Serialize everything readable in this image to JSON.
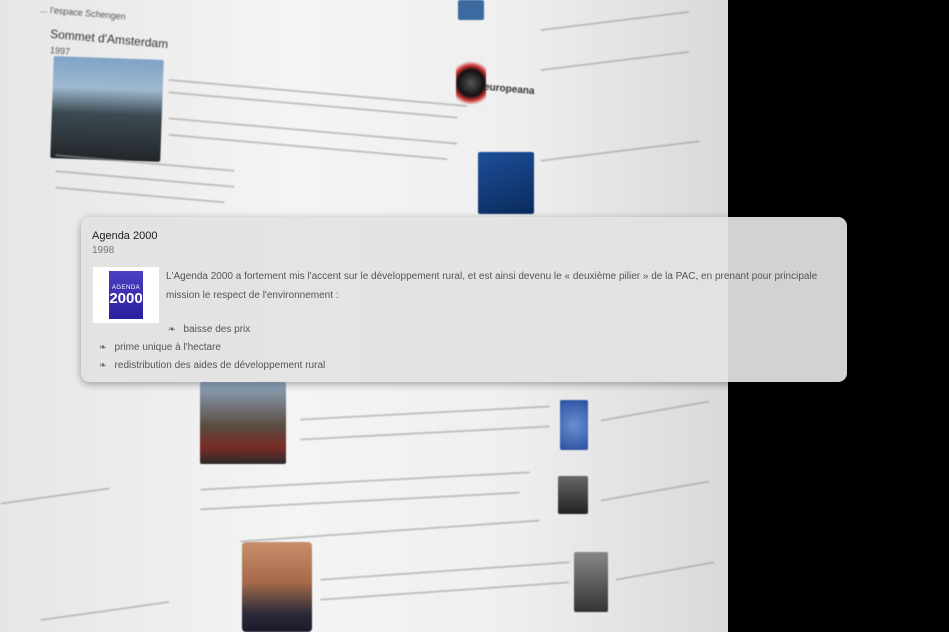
{
  "background": {
    "heading": "Sommet d'Amsterdam",
    "heading_year": "1997",
    "header_fragment": "... l'espace Schengen",
    "europeana_label": "europeana",
    "colors": {
      "page": "#000000",
      "card": "#e2e2e2",
      "logo": "#3b2fb0"
    }
  },
  "card": {
    "title": "Agenda 2000",
    "year": "1998",
    "description": "L'Agenda 2000 a fortement mis l'accent sur le développement rural, et est ainsi devenu le « deuxième pilier » de la PAC, en prenant pour principale mission le respect de l'environnement :",
    "bullets": [
      "baisse des prix",
      "prime unique à l'hectare",
      "redistribution des aides de développement rural"
    ],
    "bullet_icon": "fleuron-icon",
    "image": {
      "icon": "agenda-2000-logo",
      "logo_top": "AGENDA",
      "logo_bottom": "2000"
    }
  }
}
